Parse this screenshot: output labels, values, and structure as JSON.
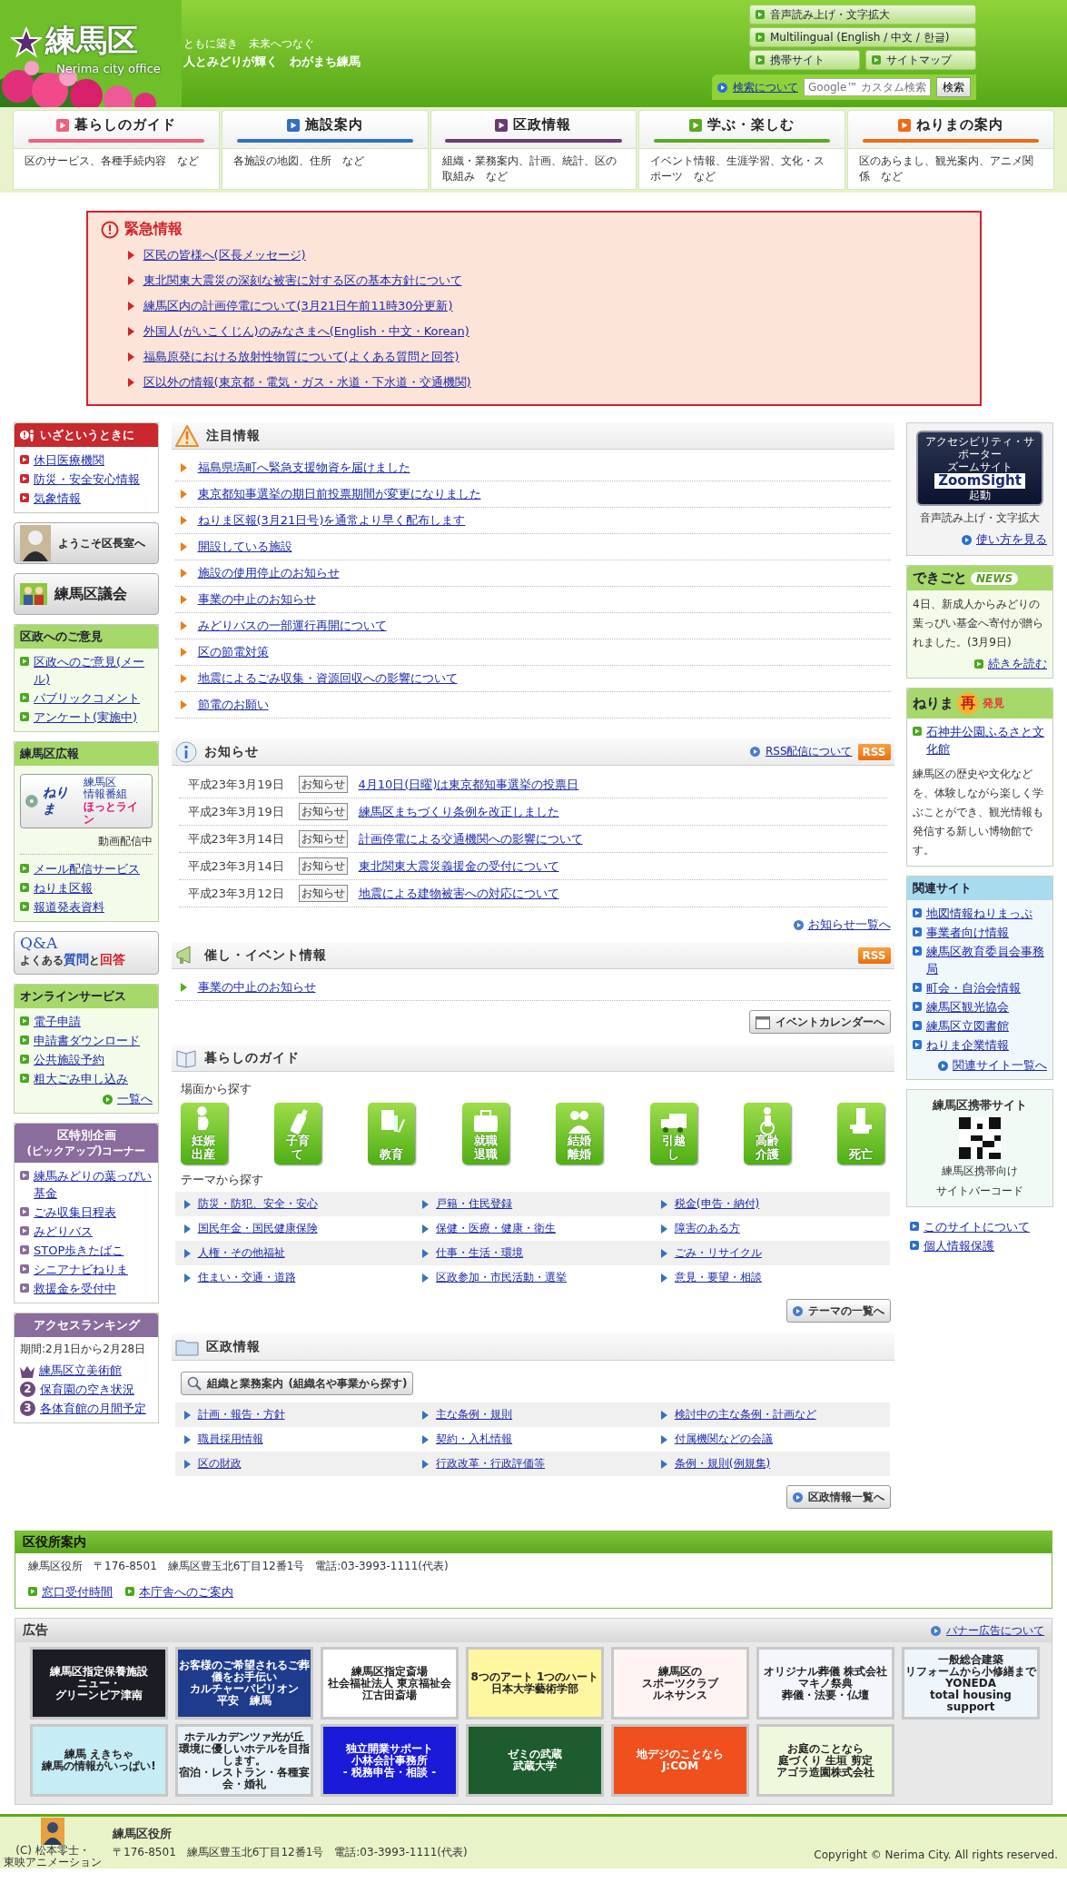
{
  "header": {
    "logo_text": "練馬区",
    "logo_sub": "Nerima city office",
    "tagline_1": "ともに築き　未来へつなぐ",
    "tagline_2": "人とみどりが輝く　わがまち練馬",
    "tools": [
      "音声読み上げ・文字拡大",
      "Multilingual (English / 中文 / 한글)",
      "携帯サイト",
      "サイトマップ"
    ],
    "search_help": "検索について",
    "search_placeholder": "Google™ カスタム検索",
    "search_button": "検索"
  },
  "nav": [
    {
      "label": "暮らしのガイド",
      "desc": "区のサービス、各種手続内容　など",
      "color": "#f0607a"
    },
    {
      "label": "施設案内",
      "desc": "各施設の地図、住所　など",
      "color": "#2f6fc6"
    },
    {
      "label": "区政情報",
      "desc": "組織・業務案内、計画、統計、区の取組み　など",
      "color": "#6b3a6e"
    },
    {
      "label": "学ぶ・楽しむ",
      "desc": "イベント情報、生涯学習、文化・スポーツ　など",
      "color": "#5aaa1e"
    },
    {
      "label": "ねりまの案内",
      "desc": "区のあらまし、観光案内、アニメ関係　など",
      "color": "#f06a14"
    }
  ],
  "emergency": {
    "title": "緊急情報",
    "links": [
      "区民の皆様へ(区長メッセージ)",
      "東北関東大震災の深刻な被害に対する区の基本方針について",
      "練馬区内の計画停電について(3月21日午前11時30分更新)",
      "外国人(がいこくじん)のみなさまへ(English・中文・Korean)",
      "福島原発における放射性物質について(よくある質問と回答)",
      "区以外の情報(東京都・電気・ガス・水道・下水道・交通機関)"
    ]
  },
  "left": [
    {
      "kind": "box",
      "color": "#c8282e",
      "title": "いざというときに",
      "links": [
        "休日医療機関",
        "防災・安全安心情報",
        "気象情報"
      ]
    },
    {
      "kind": "portrait",
      "label": "ようこそ区長室へ"
    },
    {
      "kind": "assembly",
      "label": "練馬区議会"
    },
    {
      "kind": "box",
      "color": "#a6d86a",
      "title": "区政へのご意見",
      "links": [
        "区政へのご意見(メール)",
        "パブリックコメント",
        "アンケート(実施中)"
      ]
    },
    {
      "kind": "box",
      "color": "#a6d86a",
      "title": "練馬区広報",
      "promo": {
        "brand": "ねりま",
        "tag": [
          "練馬区",
          "情報番組"
        ],
        "name": "ほっとライン"
      },
      "note": "動画配信中",
      "links": [
        "メール配信サービス",
        "ねりま区報",
        "報道発表資料"
      ]
    },
    {
      "kind": "faq",
      "label": "Q&A",
      "sub": "よくある**質問**と**回答**"
    },
    {
      "kind": "box",
      "color": "#a6d86a",
      "title": "オンラインサービス",
      "links": [
        "電子申請",
        "申請書ダウンロード",
        "公共施設予約",
        "粗大ごみ申し込み"
      ],
      "more": "一覧へ"
    },
    {
      "kind": "box",
      "color": "#8a6c9d",
      "title": "区特別企画",
      "subtitle": "(ピックアップ)コーナー",
      "links": [
        "練馬みどりの葉っぴい基金",
        "ごみ収集日程表",
        "みどりバス",
        "STOP歩きたばこ",
        "シニアナビねりま",
        "救援金を受付中"
      ]
    },
    {
      "kind": "box",
      "color": "#8a6c9d",
      "title": "アクセスランキング",
      "period": "期間:2月1日から2月28日",
      "ranking": [
        {
          "kind": "crown",
          "text": "練馬区立美術館"
        },
        {
          "kind": "number",
          "number": "2",
          "text": "保育園の空き状況"
        },
        {
          "kind": "number",
          "number": "3",
          "text": "各体育館の月間予定"
        }
      ]
    }
  ],
  "notice": {
    "title": "注目情報",
    "links": [
      "福島県塙町へ緊急支援物資を届けました",
      "東京都知事選挙の期日前投票期間が変更になりました",
      "ねりま区報(3月21日号)を通常より早く配布します",
      "開設している施設",
      "施設の使用停止のお知らせ",
      "事業の中止のお知らせ",
      "みどりバスの一部運行再開について",
      "区の節電対策",
      "地震によるごみ収集・資源回収への影響について",
      "節電のお願い"
    ]
  },
  "news": {
    "title": "お知らせ",
    "rss_link": "RSS配信について",
    "rss": "RSS",
    "rows": [
      {
        "date": "平成23年3月19日",
        "tag": "お知らせ",
        "text": "4月10日(日曜)は東京都知事選挙の投票日"
      },
      {
        "date": "平成23年3月19日",
        "tag": "お知らせ",
        "text": "練馬区まちづくり条例を改正しました"
      },
      {
        "date": "平成23年3月14日",
        "tag": "お知らせ",
        "text": "計画停電による交通機関への影響について"
      },
      {
        "date": "平成23年3月14日",
        "tag": "お知らせ",
        "text": "東北関東大震災義援金の受付について"
      },
      {
        "date": "平成23年3月12日",
        "tag": "お知らせ",
        "text": "地震による建物被害への対応について"
      }
    ],
    "more": "お知らせ一覧へ"
  },
  "events": {
    "title": "催し・イベント情報",
    "rss": "RSS",
    "links": [
      "事業の中止のお知らせ"
    ],
    "button": "イベントカレンダーへ"
  },
  "guide": {
    "title": "暮らしのガイド",
    "scene_heading": "場面から探す",
    "scenes": [
      "妊娠出産",
      "子育て",
      "教育",
      "就職退職",
      "結婚離婚",
      "引越し",
      "高齢介護",
      "死亡"
    ],
    "theme_heading": "テーマから探す",
    "themes": [
      "防災・防犯、安全・安心",
      "戸籍・住民登録",
      "税金(申告・納付)",
      "国民年金・国民健康保険",
      "保健・医療・健康・衛生",
      "障害のある方",
      "人権・その他福祉",
      "仕事・生活・環境",
      "ごみ・リサイクル",
      "住まい・交通・道路",
      "区政参加・市民活動・選挙",
      "意見・要望・相談"
    ],
    "button": "テーマの一覧へ"
  },
  "kusei": {
    "title": "区政情報",
    "org_button": "組織と業務案内",
    "org_note": "(組織名や事業から探す)",
    "links": [
      "計画・報告・方針",
      "主な条例・規則",
      "検討中の主な条例・計画など",
      "職員採用情報",
      "契約・入札情報",
      "付属機関などの会議",
      "区の財政",
      "行政改革・行政評価等",
      "条例・規則(例規集)"
    ],
    "button": "区政情報一覧へ"
  },
  "right": {
    "zoomsight": {
      "top": "アクセシビリティ・サポーター",
      "sub": "ズームサイト",
      "brand": "ZoomSight",
      "launch": "起動",
      "caption": "音声読み上げ・文字拡大",
      "link": "使い方を見る"
    },
    "dekigoto": {
      "title": "できごと",
      "badge": "NEWS",
      "text": "4日、新成人からみどりの葉っぴい基金へ寄付が贈られました。(3月9日)",
      "more": "続きを読む"
    },
    "rediscover": {
      "title": "ねりま",
      "mark": "再",
      "tail": "発見",
      "link": "石神井公園ふるさと文化館",
      "text": "練馬区の歴史や文化などを、体験しながら楽しく学ぶことができ、観光情報も発信する新しい博物館です。"
    },
    "related": {
      "title": "関連サイト",
      "links": [
        "地図情報ねりまっぷ",
        "事業者向け情報",
        "練馬区教育委員会事務局",
        "町会・自治会情報",
        "練馬区観光協会",
        "練馬区立図書館",
        "ねりま企業情報"
      ],
      "more": "関連サイト一覧へ"
    },
    "mobile": {
      "title": "練馬区携帯サイト",
      "caption": [
        "練馬区携帯向け",
        "サイトバーコード"
      ]
    },
    "links": [
      "このサイトについて",
      "個人情報保護"
    ]
  },
  "office": {
    "title": "区役所案内",
    "address": "練馬区役所　〒176-8501　練馬区豊玉北6丁目12番1号　電話:03-3993-1111(代表)",
    "links": [
      "窓口受付時間",
      "本庁舎へのご案内"
    ]
  },
  "ads": {
    "title": "広告",
    "link": "バナー広告について",
    "banners": [
      {
        "lines": [
          "練馬区指定保養施設",
          "ニュー・",
          "グリーンピア津南"
        ],
        "color": "#1c1c24"
      },
      {
        "lines": [
          "お客様のご希望されるご葬儀をお手伝い",
          "カルチャーパビリオン",
          "平安　練馬"
        ],
        "color": "#1f3c8c"
      },
      {
        "lines": [
          "練馬区指定斎場",
          "社会福祉法人 東京福祉会",
          "江古田斎場"
        ],
        "color": "#ffffff"
      },
      {
        "lines": [
          "8つのアート 1つのハート",
          "日本大学藝術学部"
        ],
        "color": "#fff6a0"
      },
      {
        "lines": [
          "練馬区の",
          "スポーツクラブ",
          "ルネサンス"
        ],
        "color": "#fff4f4"
      },
      {
        "lines": [
          "オリジナル葬儀 株式会社",
          "マキノ祭典",
          "葬儀・法要・仏壇"
        ],
        "color": "#f4f6fb"
      },
      {
        "lines": [
          "一般総合建築",
          "リフォームから小修繕まで",
          "YONEDA",
          "total housing support"
        ],
        "color": "#eef5fb"
      },
      {
        "lines": [
          "練馬 えきちゃ",
          "練馬の情報がいっぱい!"
        ],
        "color": "#c6ecf6"
      },
      {
        "lines": [
          "ホテルカデンツァ光が丘",
          "環境に優しいホテルを目指します。",
          "宿泊・レストラン・各種宴会・婚礼"
        ],
        "color": "#e8f2f8"
      },
      {
        "lines": [
          "独立開業サポート",
          "小林会計事務所",
          "- 税務申告・相談 -"
        ],
        "color": "#1a1ad8"
      },
      {
        "lines": [
          "ゼミの武蔵",
          "武蔵大学"
        ],
        "color": "#1d5c2c"
      },
      {
        "lines": [
          "地デジのことなら",
          "J:COM"
        ],
        "color": "#f0501e"
      },
      {
        "lines": [
          "お庭のことなら",
          "庭づくり 生垣 剪定",
          "アゴラ造園株式会社"
        ],
        "color": "#eef8dc"
      }
    ]
  },
  "footer": {
    "credit": [
      "(C) 松本零士・",
      "東映アニメーション"
    ],
    "name": "練馬区役所",
    "address": "〒176-8501　練馬区豊玉北6丁目12番1号　電話:03-3993-1111(代表)",
    "copyright": "Copyright © Nerima City. All rights reserved."
  }
}
